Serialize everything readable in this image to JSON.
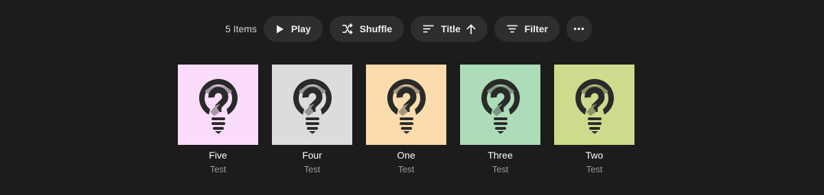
{
  "toolbar": {
    "count": "5 Items",
    "play_label": "Play",
    "shuffle_label": "Shuffle",
    "sort_label": "Title",
    "filter_label": "Filter"
  },
  "items": [
    {
      "title": "Five",
      "subtitle": "Test",
      "color": "#fcdcfc"
    },
    {
      "title": "Four",
      "subtitle": "Test",
      "color": "#dcdcdc"
    },
    {
      "title": "One",
      "subtitle": "Test",
      "color": "#fcdcac"
    },
    {
      "title": "Three",
      "subtitle": "Test",
      "color": "#acdcb8"
    },
    {
      "title": "Two",
      "subtitle": "Test",
      "color": "#ccdc8c"
    }
  ],
  "icons": {
    "play": "play-icon",
    "shuffle": "shuffle-icon",
    "sort": "sort-lines-icon",
    "sort_direction": "arrow-up-icon",
    "filter": "filter-icon",
    "more": "more-dots-icon",
    "artwork": "lightbulb-question-puzzle-icon"
  }
}
